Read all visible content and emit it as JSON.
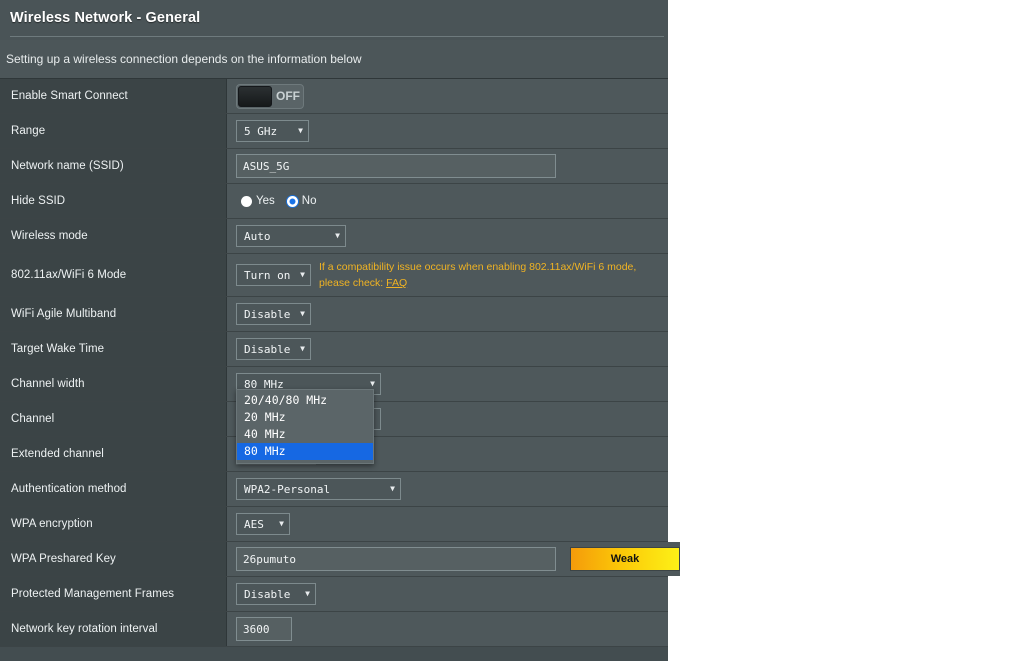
{
  "header": {
    "title": "Wireless Network - General",
    "subtitle": "Setting up a wireless connection depends on the information below"
  },
  "rows": {
    "smart_connect": {
      "label": "Enable Smart Connect",
      "toggle_state": "OFF"
    },
    "range": {
      "label": "Range",
      "value": "5 GHz"
    },
    "ssid": {
      "label": "Network name (SSID)",
      "value": "ASUS_5G"
    },
    "hide_ssid": {
      "label": "Hide SSID",
      "yes": "Yes",
      "no": "No",
      "selected": "No"
    },
    "wireless_mode": {
      "label": "Wireless mode",
      "value": "Auto"
    },
    "ax_mode": {
      "label": "802.11ax/WiFi 6 Mode",
      "value": "Turn on",
      "note_line1": "If a compatibility issue occurs when enabling 802.11ax/WiFi 6 mode,",
      "note_line2_prefix": "please check: ",
      "note_link": "FAQ"
    },
    "agile_multiband": {
      "label": "WiFi Agile Multiband",
      "value": "Disable"
    },
    "target_wake_time": {
      "label": "Target Wake Time",
      "value": "Disable"
    },
    "channel_width": {
      "label": "Channel width",
      "value": "80 MHz",
      "options": [
        "20/40/80 MHz",
        "20 MHz",
        "40 MHz",
        "80 MHz"
      ],
      "selected_option": "80 MHz"
    },
    "channel": {
      "label": "Channel"
    },
    "extended_channel": {
      "label": "Extended channel"
    },
    "auth_method": {
      "label": "Authentication method",
      "value": "WPA2-Personal"
    },
    "wpa_encryption": {
      "label": "WPA encryption",
      "value": "AES"
    },
    "wpa_key": {
      "label": "WPA Preshared Key",
      "value": "26pumuto",
      "strength_badge": "Weak"
    },
    "pmf": {
      "label": "Protected Management Frames",
      "value": "Disable"
    },
    "key_rotation": {
      "label": "Network key rotation interval",
      "value": "3600"
    }
  },
  "icons": {
    "chevron_down": "⌄"
  },
  "colors": {
    "panel_bg": "#4e585b",
    "label_bg": "#3b4446",
    "accent_blue": "#1668e3",
    "warning_amber": "#f0b323"
  }
}
